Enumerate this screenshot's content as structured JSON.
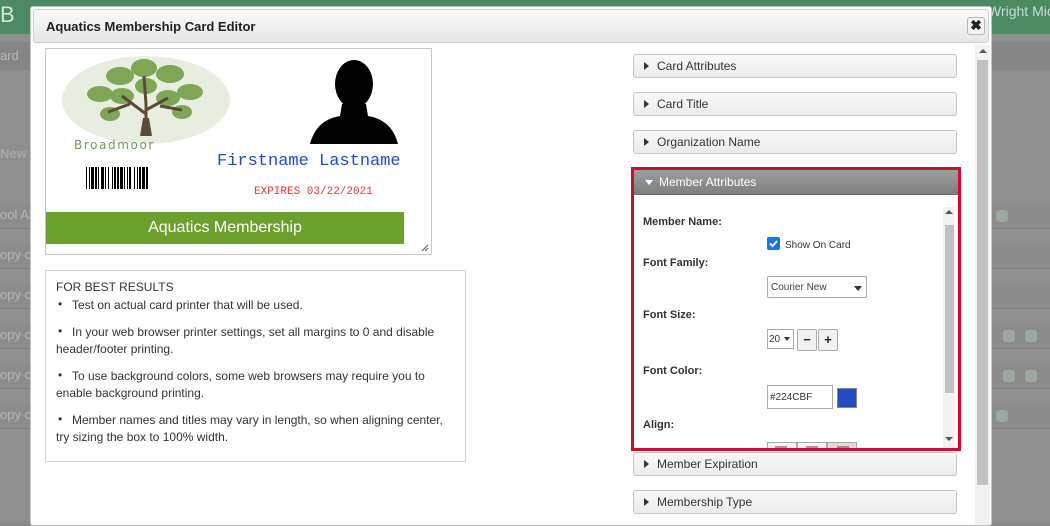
{
  "background": {
    "app_title": "B",
    "user_name": "Wright Mic",
    "nav_text": "ard",
    "section_text": "New C",
    "row_texts": [
      "ool Al",
      "opy of",
      "opy of",
      "opy of",
      "opy of",
      "opy of"
    ]
  },
  "modal": {
    "title": "Aquatics Membership Card Editor",
    "close_symbol": "✖"
  },
  "card": {
    "org_name": "Broadmoor",
    "member_name": "Firstname Lastname",
    "expires": "EXPIRES 03/22/2021",
    "title": "Aquatics Membership",
    "name_color": "#224CBF",
    "title_bar_color": "#6BA02F",
    "expires_color": "#E53B3B"
  },
  "tips": {
    "heading": "FOR BEST RESULTS",
    "items": [
      "Test on actual card printer that will be used.",
      "In your web browser printer settings, set all margins to 0 and disable header/footer printing.",
      "To use background colors, some web browsers may require you to enable background printing.",
      "Member names and titles may vary in length, so when aligning center, try sizing the box to 100% width."
    ],
    "bullet": "•"
  },
  "accordion": {
    "sections": [
      "Card Attributes",
      "Card Title",
      "Organization Name",
      "Member Attributes",
      "Member Expiration",
      "Membership Type"
    ]
  },
  "member_attributes": {
    "member_name_label": "Member Name:",
    "show_on_card_label": "Show On Card",
    "show_on_card_checked": true,
    "font_family_label": "Font Family:",
    "font_family_value": "Courier New",
    "font_size_label": "Font Size:",
    "font_size_value": "20",
    "decrement": "−",
    "increment": "+",
    "font_color_label": "Font Color:",
    "font_color_value": "#224CBF",
    "align_label": "Align:",
    "align_selected": "right",
    "highlight_color": "#C8102E"
  }
}
